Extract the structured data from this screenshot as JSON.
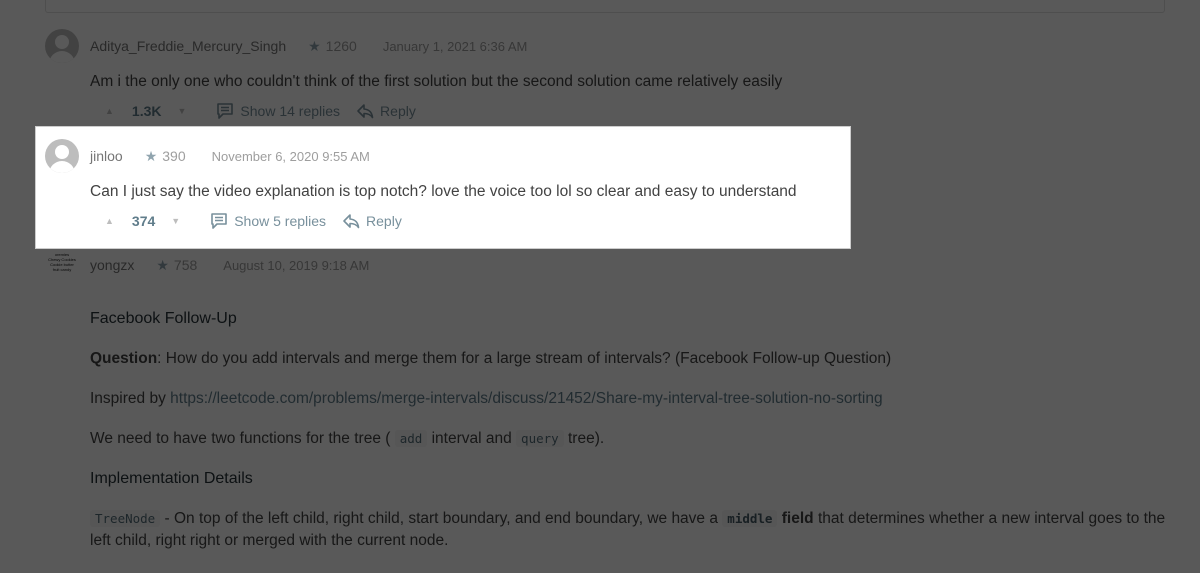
{
  "comments": [
    {
      "username": "Aditya_Freddie_Mercury_Singh",
      "reputation": "1260",
      "date": "January 1, 2021 6:36 AM",
      "body": "Am i the only one who couldn't think of the first solution but the second solution came relatively easily",
      "votes": "1.3K",
      "replies_label": "Show 14 replies",
      "reply_label": "Reply",
      "avatar": "default-avatar-icon"
    },
    {
      "username": "jinloo",
      "reputation": "390",
      "date": "November 6, 2020 9:55 AM",
      "body": "Can I just say the video explanation is top notch? love the voice too lol so clear and easy to understand",
      "votes": "374",
      "replies_label": "Show 5 replies",
      "reply_label": "Reply",
      "avatar": "default-avatar-icon",
      "highlighted": true
    },
    {
      "username": "yongzx",
      "reputation": "758",
      "date": "August 10, 2019 9:18 AM",
      "avatar_text": [
        "oremies",
        "Chewy Cookies",
        "Cookie butter",
        "fruit candy"
      ]
    }
  ],
  "post": {
    "heading": "Facebook Follow-Up",
    "question_label": "Question",
    "question_text": ": How do you add intervals and merge them for a large stream of intervals? (Facebook Follow-up Question)",
    "inspired_prefix": "Inspired by ",
    "inspired_link": "https://leetcode.com/problems/merge-intervals/discuss/21452/Share-my-interval-tree-solution-no-sorting",
    "functions_prefix": "We need to have two functions for the tree ( ",
    "functions_code1": "add",
    "functions_mid": " interval and ",
    "functions_code2": "query",
    "functions_suffix": " tree).",
    "impl_heading": "Implementation Details",
    "treenode_code": "TreeNode",
    "treenode_text1": " - On top of the left child, right child, start boundary, and end boundary, we have a ",
    "middle_code": "middle",
    "field_bold": "field",
    "treenode_text2": " that determines whether a new interval goes to the left child, right right or merged with the current node."
  },
  "overlay": {
    "dim_color": "#000000",
    "dim_opacity": 0.65
  }
}
